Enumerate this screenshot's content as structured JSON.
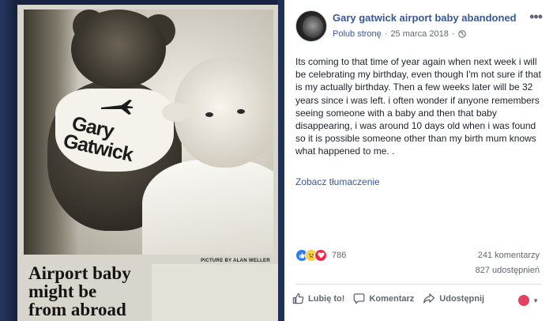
{
  "photo": {
    "shirt_text_line1": "Gary",
    "shirt_text_line2": "Gatwick",
    "credit": "PICTURE BY ALAN WELLER",
    "headline": [
      "Airport baby",
      "might be",
      "from abroad"
    ]
  },
  "post": {
    "page_name": "Gary gatwick airport baby abandoned",
    "like_page_label": "Polub stronę",
    "separator": "·",
    "date": "25 marca 2018",
    "privacy_icon": "globe-icon",
    "more_icon": "more-dots-icon",
    "text": "Its coming to that time of year again when next week i will be celebrating my birthday, even though I'm not sure if that is my actually birthday. Then a few weeks later will be 32 years since i was left. i often wonder if anyone remembers seeing someone with a baby and then that baby disappearing, i was around 10 days old when i was found so it is possible someone other than my birth mum knows what happened to me. .",
    "translate_label": "Zobacz tłumaczenie"
  },
  "stats": {
    "reactions_count": "786",
    "reaction_icons": [
      "like-icon",
      "sad-icon",
      "love-icon"
    ],
    "comments": "241 komentarzy",
    "shares": "827 udostępnień"
  },
  "actions": {
    "like": "Lubię to!",
    "comment": "Komentarz",
    "share": "Udostępnij"
  },
  "colors": {
    "link_blue": "#385898",
    "text": "#1d2129",
    "muted": "#616770",
    "like_blue": "#2e7cf6",
    "love_red": "#f0284a",
    "sad_yellow": "#f7d046"
  }
}
